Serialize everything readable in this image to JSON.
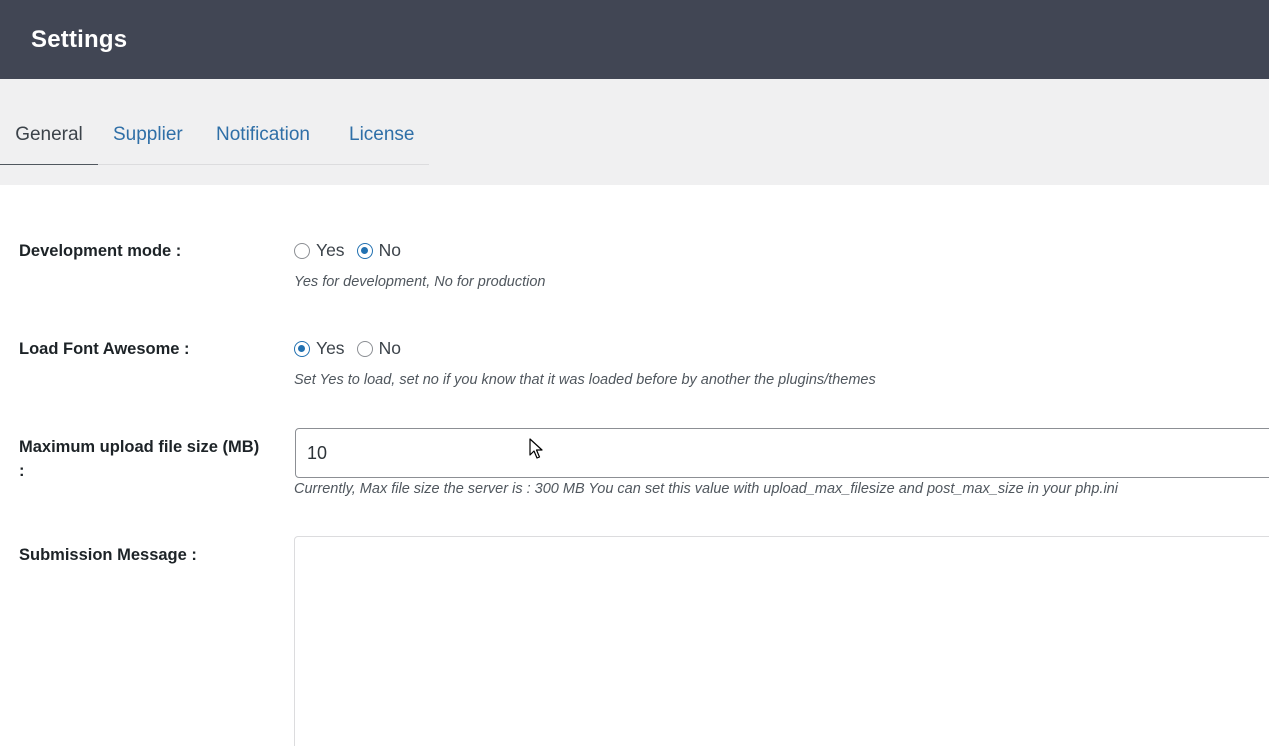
{
  "header": {
    "title": "Settings"
  },
  "tabs": [
    {
      "label": "General",
      "active": true
    },
    {
      "label": "Supplier",
      "active": false
    },
    {
      "label": "Notification",
      "active": false
    },
    {
      "label": "License",
      "active": false
    }
  ],
  "settings": {
    "development_mode": {
      "label": "Development mode :",
      "options": [
        "Yes",
        "No"
      ],
      "selected": "No",
      "help": "Yes for development, No for production"
    },
    "load_font_awesome": {
      "label": "Load Font Awesome :",
      "options": [
        "Yes",
        "No"
      ],
      "selected": "Yes",
      "help": "Set Yes to load, set no if you know that it was loaded before by another the plugins/themes"
    },
    "max_upload": {
      "label_line1": "Maximum upload file size (MB)",
      "label_line2": ":",
      "value": "10",
      "help": "Currently, Max file size the server is : 300 MB You can set this value with upload_max_filesize and post_max_size in your php.ini"
    },
    "submission_message": {
      "label": "Submission Message :",
      "value": ""
    }
  },
  "icons": {
    "cursor": "mouse-pointer-icon"
  },
  "colors": {
    "header_bg": "#414654",
    "tab_link": "#2f6fa7",
    "radio_checked": "#2271b1"
  }
}
